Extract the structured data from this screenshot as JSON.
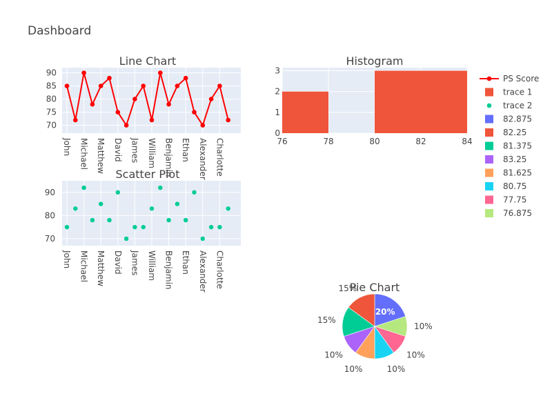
{
  "title": "Dashboard",
  "colors": {
    "plot_bg": "#e5ecf6",
    "grid": "#ffffff",
    "line": "#ff0000",
    "hist": "#ef553b",
    "scatter": "#00cc96",
    "text": "#444444"
  },
  "chart_data": [
    {
      "type": "line",
      "title": "Line Chart",
      "series": [
        {
          "name": "PS Score",
          "values": [
            85,
            72,
            90,
            78,
            85,
            88,
            75,
            70,
            80,
            85,
            72,
            90,
            78,
            85,
            88,
            75,
            70,
            80,
            85,
            72
          ]
        }
      ],
      "x_tick_labels": [
        "John",
        "Michael",
        "Matthew",
        "David",
        "James",
        "William",
        "Benjamin",
        "Ethan",
        "Alexander",
        "Charlotte"
      ],
      "ylim": [
        67,
        92
      ],
      "y_ticks": [
        70,
        75,
        80,
        85,
        90
      ],
      "grid": true
    },
    {
      "type": "bar",
      "subtype": "histogram",
      "title": "Histogram",
      "bins": [
        {
          "x0": 76,
          "x1": 78,
          "count": 2
        },
        {
          "x0": 78,
          "x1": 80,
          "count": 0
        },
        {
          "x0": 80,
          "x1": 84,
          "count": 3
        }
      ],
      "xlim": [
        76,
        84
      ],
      "x_ticks": [
        76,
        78,
        80,
        82,
        84
      ],
      "ylim": [
        0,
        3.15
      ],
      "y_ticks": [
        0,
        1,
        2,
        3
      ],
      "series_name": "trace 1"
    },
    {
      "type": "scatter",
      "title": "Scatter Plot",
      "series_name": "trace 2",
      "values": [
        75,
        83,
        92,
        78,
        85,
        78,
        90,
        70,
        75,
        75,
        83,
        92,
        78,
        85,
        78,
        90,
        70,
        75,
        75,
        83
      ],
      "x_tick_labels": [
        "John",
        "Michael",
        "Matthew",
        "David",
        "James",
        "William",
        "Benjamin",
        "Ethan",
        "Alexander",
        "Charlotte"
      ],
      "ylim": [
        67,
        95
      ],
      "y_ticks": [
        70,
        80,
        90
      ],
      "grid": true
    },
    {
      "type": "pie",
      "title": "Pie Chart",
      "slices": [
        {
          "label": "82.875",
          "percent": 20,
          "text": "20%",
          "color": "#636efa"
        },
        {
          "label": "76.875",
          "percent": 10,
          "text": "10%",
          "color": "#b6e880"
        },
        {
          "label": "77.75",
          "percent": 10,
          "text": "10%",
          "color": "#ff6692"
        },
        {
          "label": "80.75",
          "percent": 10,
          "text": "10%",
          "color": "#19d3f3"
        },
        {
          "label": "81.625",
          "percent": 10,
          "text": "10%",
          "color": "#ffa15a"
        },
        {
          "label": "83.25",
          "percent": 10,
          "text": "10%",
          "color": "#ab63fa"
        },
        {
          "label": "81.375",
          "percent": 15,
          "text": "15%",
          "color": "#00cc96"
        },
        {
          "label": "82.25",
          "percent": 15,
          "text": "15%",
          "color": "#ef553b"
        }
      ]
    }
  ],
  "legend": {
    "position": "right",
    "items": [
      {
        "label": "PS Score",
        "symbol": "line-marker",
        "color": "#ff0000"
      },
      {
        "label": "trace 1",
        "symbol": "square",
        "color": "#ef553b"
      },
      {
        "label": "trace 2",
        "symbol": "dot",
        "color": "#00cc96"
      },
      {
        "label": "82.875",
        "symbol": "square",
        "color": "#636efa"
      },
      {
        "label": "82.25",
        "symbol": "square",
        "color": "#ef553b"
      },
      {
        "label": "81.375",
        "symbol": "square",
        "color": "#00cc96"
      },
      {
        "label": "83.25",
        "symbol": "square",
        "color": "#ab63fa"
      },
      {
        "label": "81.625",
        "symbol": "square",
        "color": "#ffa15a"
      },
      {
        "label": "80.75",
        "symbol": "square",
        "color": "#19d3f3"
      },
      {
        "label": "77.75",
        "symbol": "square",
        "color": "#ff6692"
      },
      {
        "label": "76.875",
        "symbol": "square",
        "color": "#b6e880"
      }
    ]
  }
}
